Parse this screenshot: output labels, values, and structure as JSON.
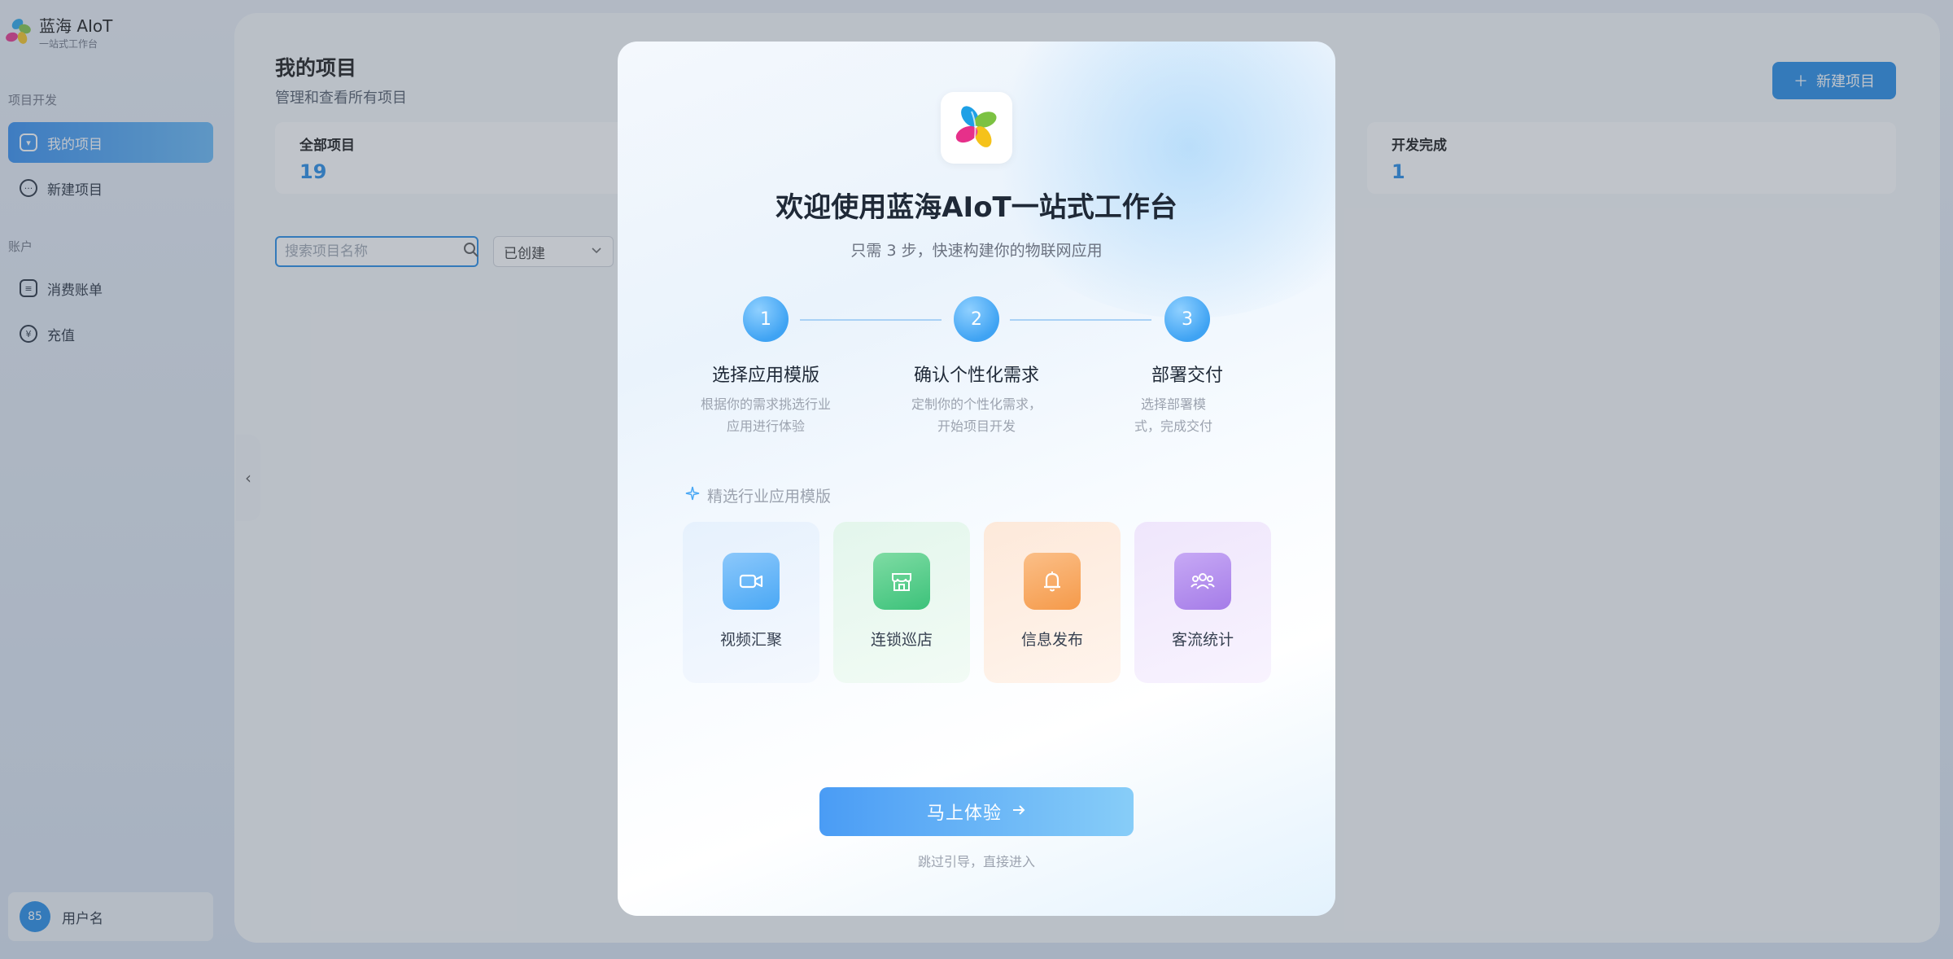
{
  "brand": {
    "title": "蓝海 AIoT",
    "subtitle": "一站式工作台"
  },
  "sidebar": {
    "sections": [
      {
        "label": "项目开发",
        "items": [
          {
            "label": "我的项目",
            "icon": "project-icon",
            "active": true
          },
          {
            "label": "新建项目",
            "icon": "chat-icon"
          }
        ]
      },
      {
        "label": "账户",
        "items": [
          {
            "label": "消费账单",
            "icon": "bill-icon"
          },
          {
            "label": "充值",
            "icon": "coins-icon"
          }
        ]
      }
    ],
    "user": {
      "avatar_text": "85",
      "name": "用户名"
    }
  },
  "header": {
    "title": "我的项目",
    "subtitle": "管理和查看所有项目",
    "new_button": "新建项目"
  },
  "stats": [
    {
      "label": "全部项目",
      "value": "19"
    },
    {
      "label": "开发完成",
      "value": "1"
    }
  ],
  "filters": {
    "search_placeholder": "搜索项目名称",
    "status_value": "已创建"
  },
  "modal": {
    "title": "欢迎使用蓝海AIoT一站式工作台",
    "subtitle": "只需 3 步，快速构建你的物联网应用",
    "steps": [
      {
        "num": "1",
        "title": "选择应用模版",
        "desc": "根据你的需求挑选行业应用进行体验"
      },
      {
        "num": "2",
        "title": "确认个性化需求",
        "desc": "定制你的个性化需求，开始项目开发"
      },
      {
        "num": "3",
        "title": "部署交付",
        "desc": "选择部署模式，完成交付"
      }
    ],
    "templates_label": "精选行业应用模版",
    "templates": [
      {
        "name": "视频汇聚",
        "icon": "video-camera-icon",
        "color": "#4aa8f5"
      },
      {
        "name": "连锁巡店",
        "icon": "store-icon",
        "color": "#3cc27a"
      },
      {
        "name": "信息发布",
        "icon": "bell-icon",
        "color": "#f59a4a"
      },
      {
        "name": "客流统计",
        "icon": "people-icon",
        "color": "#a57ce8"
      }
    ],
    "cta": "马上体验",
    "skip": "跳过引导，直接进入"
  }
}
